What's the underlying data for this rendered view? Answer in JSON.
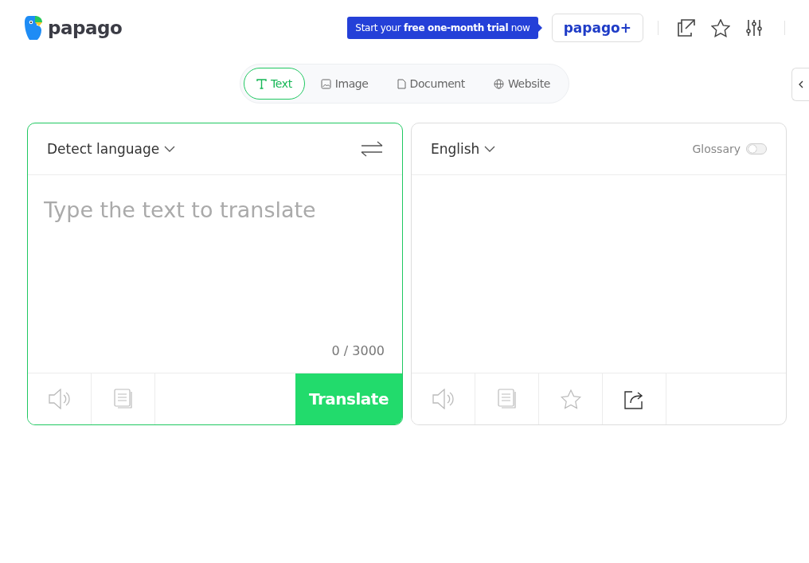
{
  "header": {
    "logo": "papago",
    "promo": "Start your **free one-month trial** now",
    "plus_button": "papago+"
  },
  "tabs": [
    {
      "kind": "text",
      "label": "Text",
      "selected": true
    },
    {
      "kind": "image",
      "label": "Image",
      "selected": false
    },
    {
      "kind": "document",
      "label": "Document",
      "selected": false
    },
    {
      "kind": "website",
      "label": "Website",
      "selected": false
    }
  ],
  "source": {
    "language": "Detect language",
    "placeholder": "Type the text to translate",
    "counter": "0 / 3000",
    "translate_button": "Translate",
    "tools": [
      {
        "kind": "speaker",
        "disabled": true
      },
      {
        "kind": "copy",
        "disabled": true
      }
    ]
  },
  "target": {
    "language": "English",
    "glossary": {
      "label": "Glossary",
      "on": false
    },
    "tools": [
      {
        "kind": "speaker",
        "disabled": true
      },
      {
        "kind": "copy",
        "disabled": true
      },
      {
        "kind": "star",
        "disabled": true
      },
      {
        "kind": "share",
        "disabled": false
      }
    ]
  }
}
